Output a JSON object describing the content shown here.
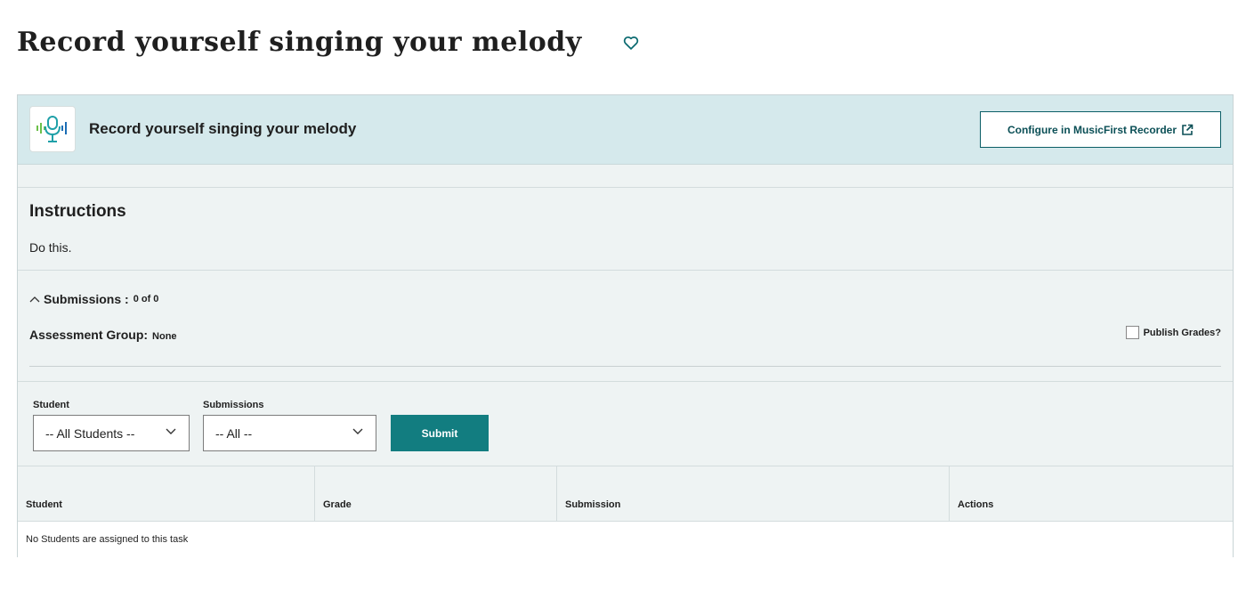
{
  "page": {
    "title": "Record yourself singing your melody"
  },
  "card": {
    "header_title": "Record yourself singing your melody",
    "configure_label": "Configure in MusicFirst Recorder",
    "app_icon": "microphone-soundwave-icon"
  },
  "instructions": {
    "heading": "Instructions",
    "text": "Do this."
  },
  "submissions": {
    "label": "Submissions :",
    "count": "0 of 0",
    "assessment_label": "Assessment Group:",
    "assessment_value": "None",
    "publish_label": "Publish Grades?"
  },
  "filters": {
    "student_label": "Student",
    "student_value": "-- All Students --",
    "submissions_label": "Submissions",
    "submissions_value": "-- All --",
    "submit_label": "Submit"
  },
  "table": {
    "columns": [
      "Student",
      "Grade",
      "Submission",
      "Actions"
    ],
    "empty_message": "No Students are assigned to this task"
  },
  "colors": {
    "accent": "#127d80",
    "header_bg": "#d5e9ec",
    "panel_bg": "#eef3f3"
  }
}
